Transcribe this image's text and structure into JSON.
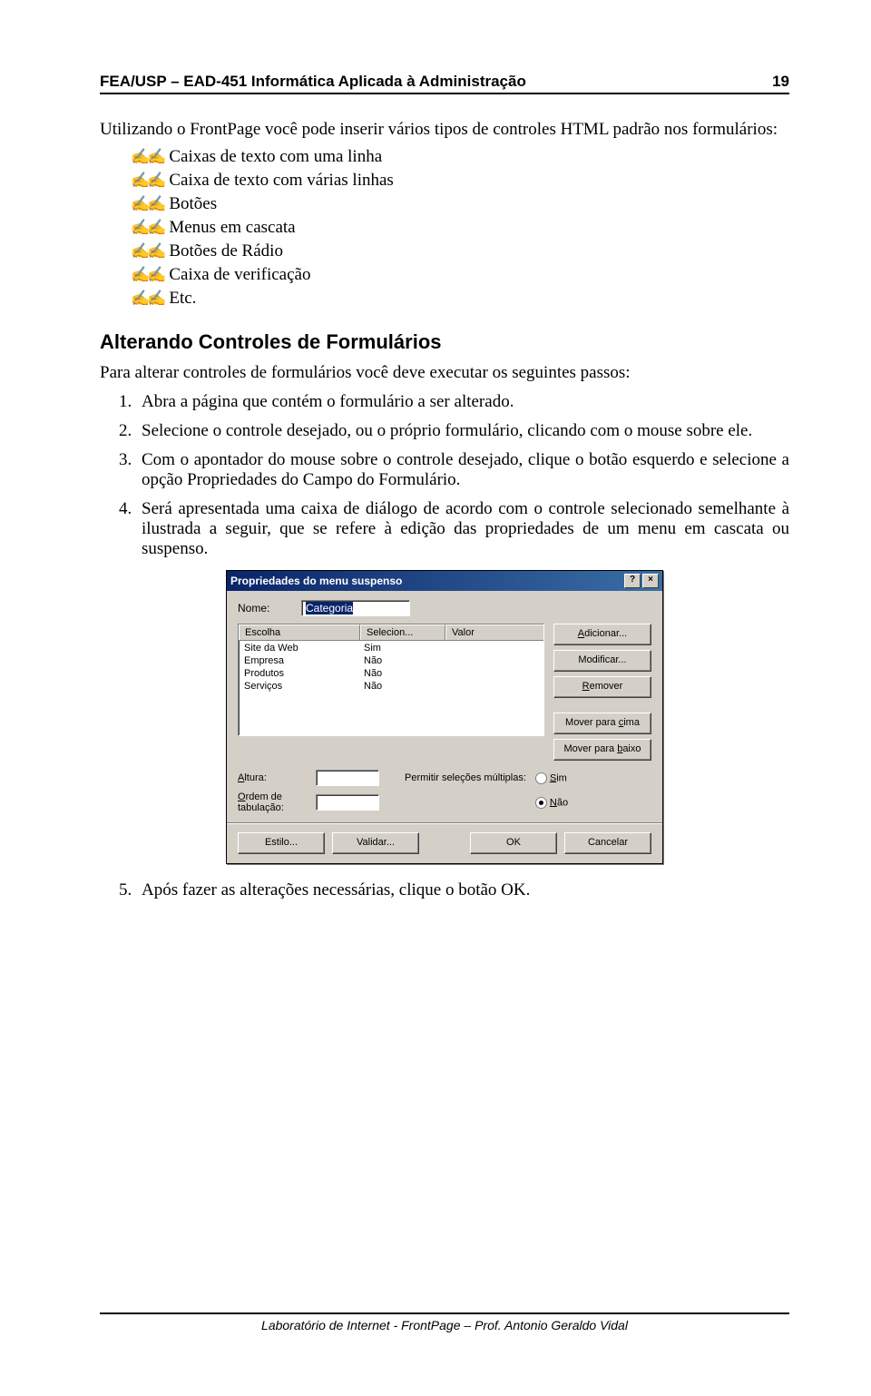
{
  "header": {
    "left": "FEA/USP – EAD-451 Informática Aplicada à Administração",
    "page": "19"
  },
  "intro": "Utilizando o FrontPage você pode inserir vários tipos de controles HTML padrão nos formulários:",
  "bullets": [
    "Caixas de texto com uma linha",
    "Caixa de texto com várias linhas",
    "Botões",
    "Menus em cascata",
    "Botões de Rádio",
    "Caixa de verificação",
    "Etc."
  ],
  "section_title": "Alterando Controles de Formulários",
  "section_intro": "Para alterar controles de formulários você deve executar os seguintes passos:",
  "steps": [
    "Abra a página que contém o formulário a ser alterado.",
    "Selecione o controle desejado, ou o próprio formulário, clicando com o mouse sobre ele.",
    "Com o apontador do mouse sobre o controle desejado, clique o botão esquerdo e selecione a opção Propriedades do Campo do Formulário.",
    "Será apresentada uma caixa de diálogo de acordo com o controle selecionado semelhante à ilustrada a seguir, que se refere à edição das propriedades de um menu em cascata ou suspenso."
  ],
  "step5": "Após fazer as alterações necessárias, clique o botão OK.",
  "dialog": {
    "title": "Propriedades do menu suspenso",
    "name_label": "Nome:",
    "name_value": "Categoria",
    "headers": {
      "c1": "Escolha",
      "c2": "Selecion...",
      "c3": "Valor"
    },
    "rows": [
      {
        "c1": "Site da Web",
        "c2": "Sim",
        "c3": ""
      },
      {
        "c1": "Empresa",
        "c2": "Não",
        "c3": ""
      },
      {
        "c1": "Produtos",
        "c2": "Não",
        "c3": ""
      },
      {
        "c1": "Serviços",
        "c2": "Não",
        "c3": ""
      }
    ],
    "side_buttons": {
      "add": "Adicionar...",
      "modify": "Modificar...",
      "remove": "Remover",
      "up": "Mover para cima",
      "down": "Mover para baixo"
    },
    "height_label": "Altura:",
    "tab_label": "Ordem de tabulação:",
    "mult_label": "Permitir seleções múltiplas:",
    "mult_yes_label": "Sim",
    "mult_no_label": "Não",
    "bottom": {
      "style": "Estilo...",
      "validate": "Validar...",
      "ok": "OK",
      "cancel": "Cancelar"
    }
  },
  "footer": "Laboratório de Internet - FrontPage – Prof. Antonio Geraldo Vidal"
}
